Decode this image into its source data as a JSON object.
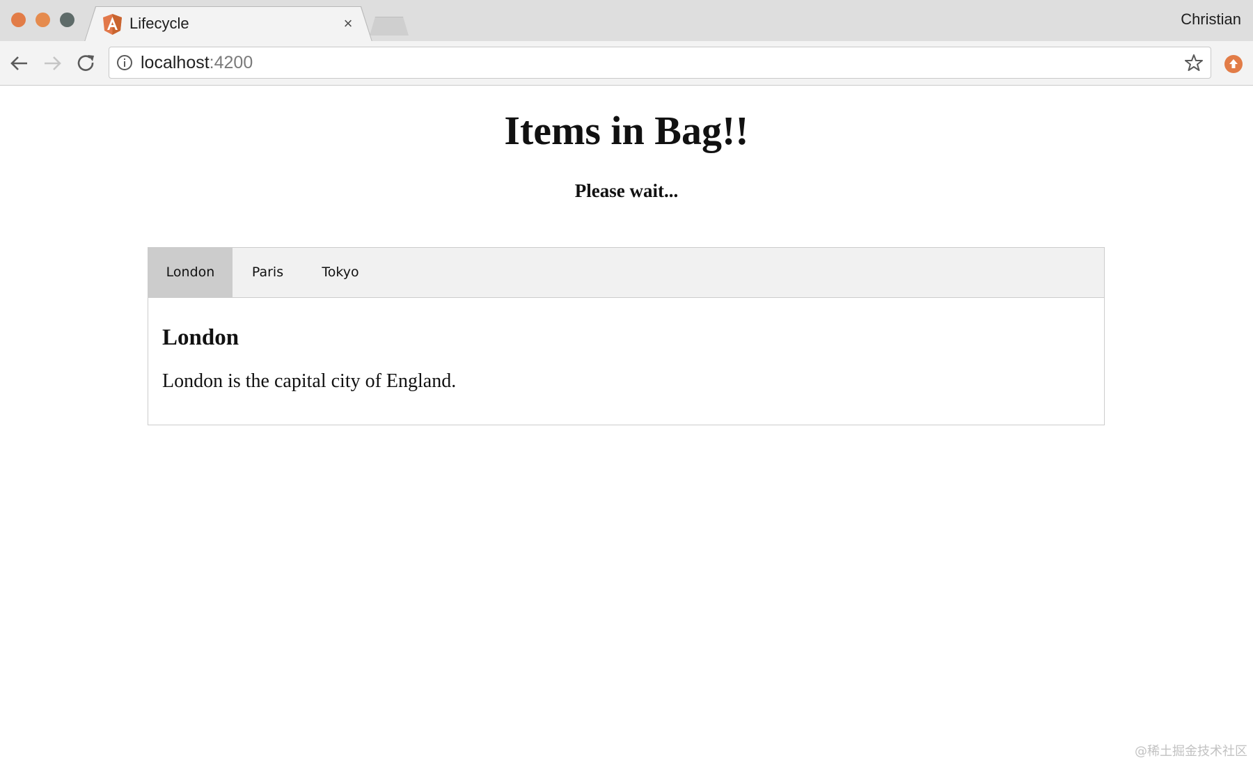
{
  "browser": {
    "tab": {
      "title": "Lifecycle",
      "close_label": "×",
      "favicon": "angular-icon"
    },
    "profile_name": "Christian",
    "address": {
      "host": "localhost",
      "port": ":4200"
    },
    "icons": {
      "back": "back-arrow-icon",
      "forward": "forward-arrow-icon",
      "reload": "reload-icon",
      "info": "info-icon",
      "bookmark": "star-icon",
      "extension": "extension-icon"
    },
    "colors": {
      "accent": "#e27c47",
      "titlebar": "#dedede",
      "toolbar": "#f3f3f3"
    }
  },
  "page": {
    "title": "Items in Bag!!",
    "status": "Please wait...",
    "tabs": [
      {
        "label": "London",
        "active": true
      },
      {
        "label": "Paris",
        "active": false
      },
      {
        "label": "Tokyo",
        "active": false
      }
    ],
    "active_panel": {
      "heading": "London",
      "text": "London is the capital city of England."
    },
    "colors": {
      "active_tab_bg": "#cccccc",
      "tab_bar_bg": "#f1f1f1"
    }
  },
  "watermark": "@稀土掘金技术社区"
}
